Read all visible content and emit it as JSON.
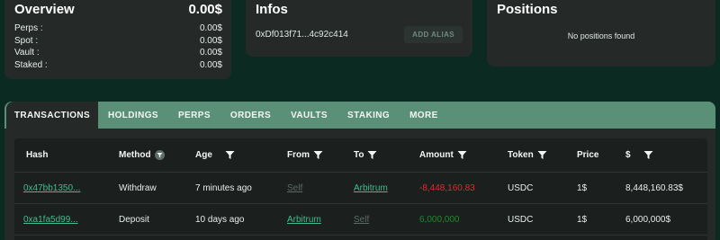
{
  "overview": {
    "title": "Overview",
    "total": "0.00$",
    "rows": [
      {
        "label": "Perps :",
        "value": "0.00$"
      },
      {
        "label": "Spot :",
        "value": "0.00$"
      },
      {
        "label": "Vault :",
        "value": "0.00$"
      },
      {
        "label": "Staked :",
        "value": "0.00$"
      }
    ]
  },
  "infos": {
    "title": "Infos",
    "address": "0xDf013f71...4c92c414",
    "alias_button": "ADD ALIAS"
  },
  "positions": {
    "title": "Positions",
    "empty_text": "No positions found"
  },
  "tabs": [
    "TRANSACTIONS",
    "HOLDINGS",
    "PERPS",
    "ORDERS",
    "VAULTS",
    "STAKING",
    "MORE"
  ],
  "active_tab": "TRANSACTIONS",
  "table": {
    "headers": {
      "hash": "Hash",
      "method": "Method",
      "age": "Age",
      "from": "From",
      "to": "To",
      "amount": "Amount",
      "token": "Token",
      "price": "Price",
      "usd": "$"
    },
    "rows": [
      {
        "hash": "0x47bb1350...",
        "method": "Withdraw",
        "age": "7 minutes ago",
        "from": "Self",
        "to": "Arbitrum",
        "amount": "-8,448,160.83",
        "token": "USDC",
        "price": "1$",
        "usd": "8,448,160.83$"
      },
      {
        "hash": "0xa1fa5d99...",
        "method": "Deposit",
        "age": "10 days ago",
        "from": "Arbitrum",
        "to": "Self",
        "amount": "6,000,000",
        "token": "USDC",
        "price": "1$",
        "usd": "6,000,000$"
      }
    ]
  },
  "colors": {
    "background": "#0b2a22",
    "card": "#252a29",
    "tab_bar": "#5a8f78",
    "link_green": "#3fbf8f",
    "negative": "#e02b2b",
    "positive": "#1f8a2c"
  }
}
